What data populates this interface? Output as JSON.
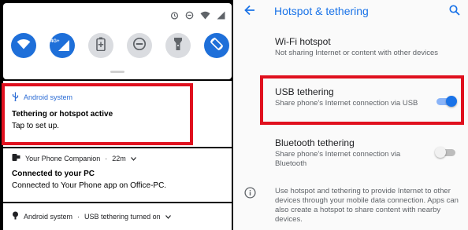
{
  "colors": {
    "accent": "#1a73e8",
    "highlight": "#e0101e",
    "tile_on": "#1e6fd9",
    "tile_off": "#dadce0"
  },
  "quick_settings": {
    "status_icons": [
      "alarm-icon",
      "do-not-disturb-icon",
      "wifi-signal-icon",
      "cell-signal-icon"
    ],
    "tiles": [
      {
        "name": "wifi-icon",
        "state": "on"
      },
      {
        "name": "mobile-data-icon",
        "label": "4G+",
        "state": "on"
      },
      {
        "name": "battery-saver-icon",
        "state": "off"
      },
      {
        "name": "do-not-disturb-icon",
        "state": "off"
      },
      {
        "name": "flashlight-icon",
        "state": "off"
      },
      {
        "name": "auto-rotate-icon",
        "state": "on"
      }
    ]
  },
  "notifications": [
    {
      "app": "Android system",
      "title": "Tethering or hotspot active",
      "text": "Tap to set up.",
      "icon": "usb-icon"
    },
    {
      "app": "Your Phone Companion",
      "time": "22m",
      "title": "Connected to your PC",
      "text": "Connected to Your Phone app on Office-PC.",
      "icon": "your-phone-icon"
    },
    {
      "app": "Android system",
      "summary": "USB tethering turned on",
      "icon": "android-icon"
    }
  ],
  "settings": {
    "title": "Hotspot & tethering",
    "items": [
      {
        "title": "Wi-Fi hotspot",
        "subtitle": "Not sharing Internet or content with other devices"
      },
      {
        "title": "USB tethering",
        "subtitle": "Share phone's Internet connection via USB",
        "toggle_on": true
      },
      {
        "title": "Bluetooth tethering",
        "subtitle": "Share phone's Internet connection via Bluetooth",
        "toggle_on": false
      }
    ],
    "info": "Use hotspot and tethering to provide Internet to other devices through your mobile data connection. Apps can also create a hotspot to share content with nearby devices."
  }
}
